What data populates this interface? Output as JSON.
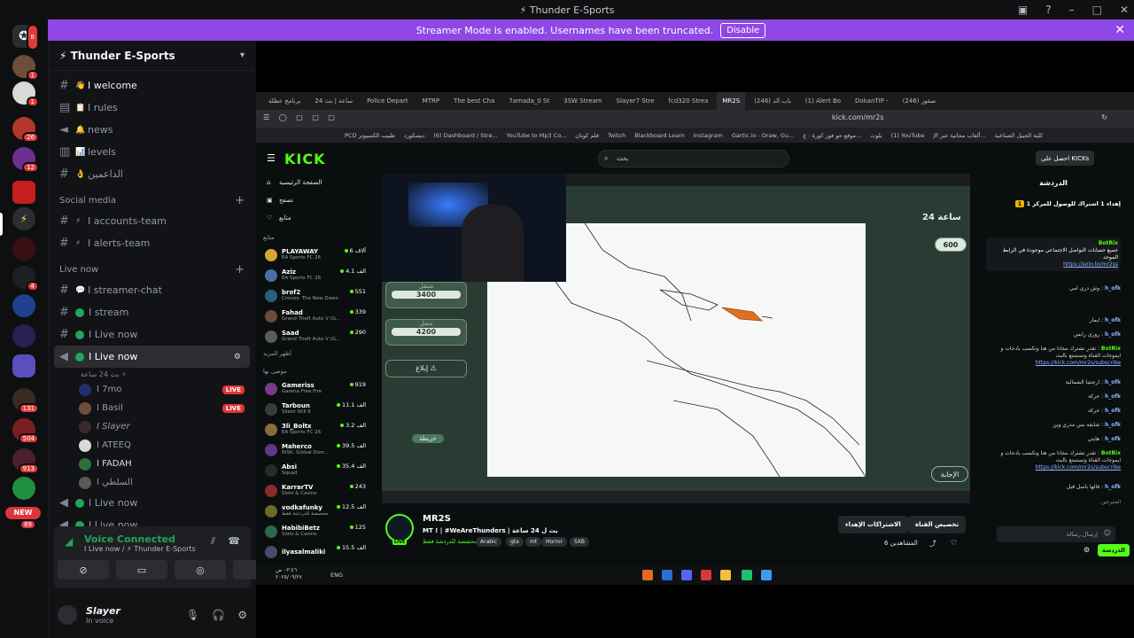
{
  "window": {
    "title": "⚡ Thunder E-Sports"
  },
  "banner": {
    "text": "Streamer Mode is enabled. Usernames have been truncated.",
    "button": "Disable"
  },
  "rail": {
    "badges": [
      "8",
      "1",
      "1",
      "26",
      "12",
      "4",
      "131",
      "504",
      "913",
      "89"
    ],
    "new_label": "NEW"
  },
  "server": {
    "name": "⚡ Thunder E-Sports",
    "channels": [
      {
        "emoji": "👋",
        "name": "I welcome"
      },
      {
        "emoji": "📋",
        "name": "I rules"
      },
      {
        "emoji": "🔔",
        "name": "news"
      },
      {
        "emoji": "📊",
        "name": "levels"
      },
      {
        "emoji": "👌",
        "name": "الداعمين"
      }
    ],
    "social_category": "Social media",
    "social_channels": [
      {
        "emoji": "⚡",
        "name": "I accounts-team"
      },
      {
        "emoji": "⚡",
        "name": "I alerts-team"
      }
    ],
    "live_category": "Live now",
    "live_channels": [
      {
        "name": "I streamer-chat"
      },
      {
        "name": "I stream"
      },
      {
        "name": "I Live now"
      }
    ],
    "active_voice": {
      "name": "I Live now",
      "sub": "بث 24 ساعة ⚡"
    },
    "voice_users": [
      {
        "name": "I 7mo",
        "live": "LIVE"
      },
      {
        "name": "I Basil",
        "live": "LIVE"
      },
      {
        "name": "I  Slayer",
        "live": ""
      },
      {
        "name": "I ATEEQ",
        "live": ""
      },
      {
        "name": "I FADAH",
        "live": ""
      },
      {
        "name": "I السلطي",
        "live": ""
      }
    ],
    "more_voice": [
      "I Live now",
      "I Live now"
    ]
  },
  "voice": {
    "status": "Voice Connected",
    "channel": "I Live now / ⚡ Thunder E-Sports"
  },
  "user": {
    "name": "Slayer",
    "status": "In voice"
  },
  "browser": {
    "tabs": [
      "برنامج عطلة",
      "24 ساعة | بث",
      "Police Depart",
      "MTRP",
      "The best Cha",
      "7amada_0 St",
      "3SW Stream",
      "Slayer7 Stre",
      "fcd320 Strea",
      "MR2S",
      "(246) باب الد",
      "(1) Alert Bo",
      "DokanTIP -",
      "(246) صقور"
    ],
    "url": "kick.com/mr2s",
    "bookmarks": [
      "PCD طبيب الكمبيوتر",
      "ديسكورد",
      "(6) Dashboard / Stre...",
      "YouTube to Mp3 Co...",
      "قلم كوتان",
      "Twitch",
      "Blackboard Learn",
      "Instagram",
      "Gartic.io - Draw, Gu...",
      "موقع جو فور كورة : ع...",
      "بلوت",
      "(1) YouTube",
      "ألعاب مجانية عبر الإ...",
      "كلية الجبيل الصناعية"
    ]
  },
  "kick": {
    "logo": "KICK",
    "search_placeholder": "بحث",
    "get_kicks": "احصل على KICKs",
    "nav": [
      "الصفحة الرئيسية",
      "تصفح",
      "متابع"
    ],
    "following_label": "متابع",
    "following": [
      {
        "name": "PLAYAWAY",
        "game": "EA Sports FC 26",
        "viewers": "6 آلاف"
      },
      {
        "name": "Aziz",
        "game": "EA Sports FC 26",
        "viewers": "4.1 الف"
      },
      {
        "name": "brof2",
        "game": "Cronos: The New Dawn",
        "viewers": "551"
      },
      {
        "name": "Fahad",
        "game": "Grand Theft Auto V (G...",
        "viewers": "339"
      },
      {
        "name": "Saad",
        "game": "Grand Theft Auto V (G...",
        "viewers": "290"
      }
    ],
    "show_more": "أظهر المزيد",
    "recommended_label": "موصى بها",
    "recommended": [
      {
        "name": "Gameriss",
        "game": "Garena Free Fire",
        "viewers": "919"
      },
      {
        "name": "Tarboun",
        "game": "Silent Still II",
        "viewers": "11.1 الف"
      },
      {
        "name": "3li_Boltx",
        "game": "EA Sports FC 26",
        "viewers": "3.2 الف"
      },
      {
        "name": "Maherco",
        "game": "RISK: Global Dom...",
        "viewers": "39.5 الف"
      },
      {
        "name": "Absi",
        "game": "Squad",
        "viewers": "35.4 الف"
      },
      {
        "name": "KarrarTV",
        "game": "Slots & Casino",
        "viewers": "243"
      },
      {
        "name": "vodkafunky",
        "game": "مخصصة للدردشة فقط",
        "viewers": "12.5 الف"
      },
      {
        "name": "HabibiBetz",
        "game": "Slots & Casino",
        "viewers": "125"
      },
      {
        "name": "ilyasalmaliki",
        "game": "",
        "viewers": "15.5 الف"
      }
    ],
    "game": {
      "score": "600",
      "btn1_label": "شنقل",
      "btn1_value": "3400",
      "btn2_label": "منقل",
      "btn2_value": "4200",
      "report": "إبلاغ ⚠",
      "map_label": "خريطة",
      "answer": "الإجابة",
      "top_label": "24 ساعة"
    },
    "stream": {
      "channel": "MR2S",
      "live": "LIVE",
      "title": "MT ! | #WeAreThunders | بث ل 24 ساعة",
      "category": "مخصصة للدردشة فقط",
      "tags": [
        "Arabic",
        "gta",
        "mt",
        "Horror",
        "SXB"
      ],
      "custom_btn": "تخصيص القناة",
      "subs_btn": "الاشتراكات الإهداء",
      "viewers": "المشاهدين 6"
    },
    "chat": {
      "title": "الدردشة",
      "pinned": "إهداء 1 اشتراك للوصول للمركز 1",
      "bot_name": "BotRix",
      "pinned_msg": "جميع حسابات التواصل الاجتماعي موجودة في الرابط الموحد",
      "pinned_link": "https://solo.to/mr2ss",
      "messages": [
        {
          "user": "h_ofk",
          "text": "وش دري امي"
        },
        {
          "user": "h_ofk",
          "text": "ايمار"
        },
        {
          "user": "h_ofk",
          "text": "روزي رابس"
        },
        {
          "user": "BotRix",
          "text": "تقدر تشترك مجانا من هنا وتكسب بادجات و ايموجات القناة وتستمتع بالبث",
          "link": "https://kick.com/mr2s/subscribe"
        },
        {
          "user": "h_ofk",
          "text": "ارجنتيا الشمالية"
        },
        {
          "user": "h_ofk",
          "text": "حركة"
        },
        {
          "user": "h_ofk",
          "text": "حركة"
        },
        {
          "user": "h_ofk",
          "text": "شايفه بس مدري وين"
        },
        {
          "user": "h_ofk",
          "text": "هايتي"
        },
        {
          "user": "BotRix",
          "text": "تقدر تشترك مجانا من هنا وتكسب بادجات و ايموجات القناة وتستمتع بالبث",
          "link": "https://kick.com/mr2s/subscribe"
        },
        {
          "user": "h_ofk",
          "text": "فالها باسل قبل"
        }
      ],
      "input_placeholder": "إرسال رسالة",
      "send": "الدردشة",
      "recent_label": "المتبرعين"
    }
  },
  "taskbar": {
    "time": "٠٣:٤٦ ص",
    "date": "٢٠٢٥/٠٩/٢٧",
    "lang": "ENG"
  },
  "colors": {
    "discord_accent": "#8f47e5",
    "kick_green": "#53fc18",
    "live_red": "#da373c",
    "voice_green": "#23a55a"
  }
}
